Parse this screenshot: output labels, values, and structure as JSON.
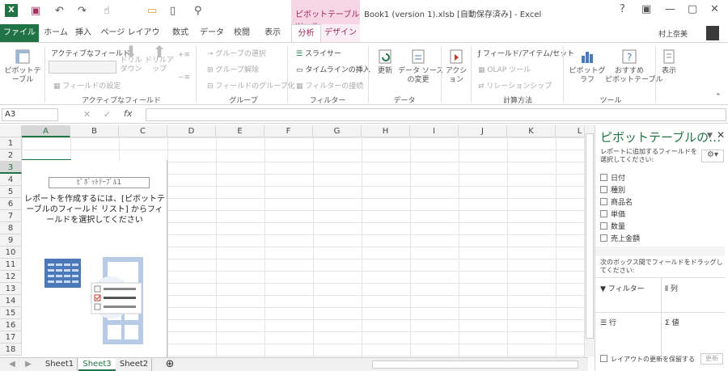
{
  "title": {
    "context_tab": "ピボットテーブル ツール",
    "window": "Book1 (version 1).xlsb [自動保存済み] - Excel",
    "user": "村上奈美"
  },
  "tabs": [
    "ファイル",
    "ホーム",
    "挿入",
    "ページ レイアウト",
    "数式",
    "データ",
    "校閲",
    "表示",
    "分析",
    "デザイン"
  ],
  "ribbon": {
    "pivottable": "ピボットテーブル",
    "active_field": "アクティブなフィールド:",
    "field_settings": "フィールドの設定",
    "drill_down": "ドリル\nダウン",
    "drill_up": "ドリルアップ",
    "group_selection": "グループの選択",
    "ungroup": "グループ解除",
    "group_field": "フィールドのグループ化",
    "slicer": "スライサー",
    "timeline": "タイムラインの挿入",
    "filter_conn": "フィルターの接続",
    "refresh": "更新",
    "change_source": "データ ソース\nの変更",
    "actions": "アクション",
    "fields_items": "フィールド/アイテム/セット",
    "olap": "OLAP ツール",
    "relationships": "リレーションシップ",
    "pivotchart": "ピボットグラフ",
    "recommended": "おすすめ\nピボットテーブル",
    "show": "表示",
    "groups": {
      "active_field": "アクティブなフィールド",
      "group": "グループ",
      "filter": "フィルター",
      "data": "データ",
      "calc": "計算方法",
      "tools": "ツール"
    }
  },
  "formula": {
    "namebox": "A3",
    "cancel": "✕",
    "enter": "✓",
    "fx": "fx",
    "content": ""
  },
  "grid": {
    "columns": [
      "A",
      "B",
      "C",
      "D",
      "E",
      "F",
      "G",
      "H",
      "I",
      "J",
      "K",
      "L"
    ],
    "rows": [
      "1",
      "2",
      "3",
      "4",
      "5",
      "6",
      "7",
      "8",
      "9",
      "10",
      "11",
      "12",
      "13",
      "14",
      "15",
      "16",
      "17",
      "18"
    ],
    "selected": "A3"
  },
  "pivot": {
    "label": "ﾋﾟﾎﾞｯﾄﾃｰﾌﾞﾙ1",
    "message": "レポートを作成するには、[ピボットテーブルのフィールド リスト] からフィールドを選択してください"
  },
  "sheets": [
    "Sheet1",
    "Sheet3",
    "Sheet2"
  ],
  "active_sheet": "Sheet3",
  "pane": {
    "title": "ピボットテーブルの…",
    "instruction": "レポートに追加するフィールドを選択してください:",
    "fields": [
      "日付",
      "種別",
      "商品名",
      "単価",
      "数量",
      "売上金額"
    ],
    "drag_instruction": "次のボックス間でフィールドをドラッグしてください:",
    "areas": {
      "filters": "フィルター",
      "columns": "列",
      "rows": "行",
      "values": "値"
    },
    "defer": "レイアウトの更新を保留する",
    "update": "更新"
  },
  "colors": {
    "excel_green": "#217346",
    "pivot_pink": "#a0285b"
  }
}
